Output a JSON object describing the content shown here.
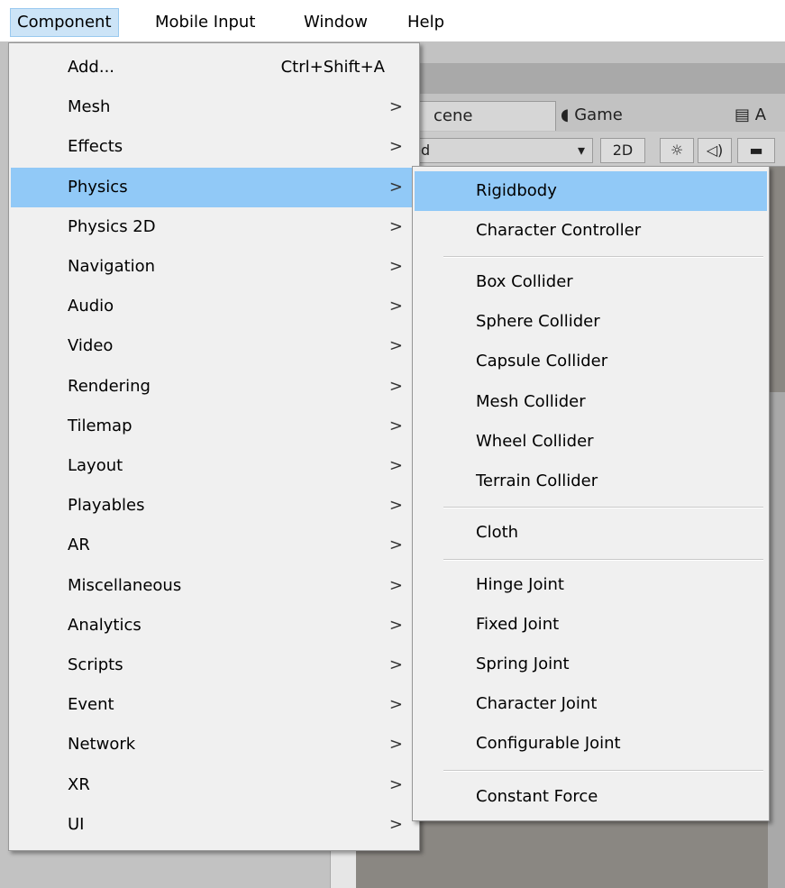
{
  "menubar": {
    "items": [
      "Component",
      "Mobile Input",
      "Window",
      "Help"
    ]
  },
  "editor": {
    "tabs": {
      "scene": "cene",
      "game": "Game",
      "asset": "A"
    },
    "toolbar": {
      "shading": "ded",
      "mode_2d": "2D",
      "dropdown_arrow": "▾"
    }
  },
  "component_menu": {
    "items": [
      {
        "label": "Add...",
        "shortcut": "Ctrl+Shift+A"
      },
      {
        "label": "Mesh",
        "arrow": ">"
      },
      {
        "label": "Effects",
        "arrow": ">"
      },
      {
        "label": "Physics",
        "arrow": ">"
      },
      {
        "label": "Physics 2D",
        "arrow": ">"
      },
      {
        "label": "Navigation",
        "arrow": ">"
      },
      {
        "label": "Audio",
        "arrow": ">"
      },
      {
        "label": "Video",
        "arrow": ">"
      },
      {
        "label": "Rendering",
        "arrow": ">"
      },
      {
        "label": "Tilemap",
        "arrow": ">"
      },
      {
        "label": "Layout",
        "arrow": ">"
      },
      {
        "label": "Playables",
        "arrow": ">"
      },
      {
        "label": "AR",
        "arrow": ">"
      },
      {
        "label": "Miscellaneous",
        "arrow": ">"
      },
      {
        "label": "Analytics",
        "arrow": ">"
      },
      {
        "label": "Scripts",
        "arrow": ">"
      },
      {
        "label": "Event",
        "arrow": ">"
      },
      {
        "label": "Network",
        "arrow": ">"
      },
      {
        "label": "XR",
        "arrow": ">"
      },
      {
        "label": "UI",
        "arrow": ">"
      }
    ],
    "highlighted": "Physics"
  },
  "physics_menu": {
    "items": [
      "Rigidbody",
      "Character Controller",
      "Box Collider",
      "Sphere Collider",
      "Capsule Collider",
      "Mesh Collider",
      "Wheel Collider",
      "Terrain Collider",
      "Cloth",
      "Hinge Joint",
      "Fixed Joint",
      "Spring Joint",
      "Character Joint",
      "Configurable Joint",
      "Constant Force"
    ],
    "highlighted": "Rigidbody"
  },
  "colors": {
    "menu_bg": "#f0f0f0",
    "highlight": "#91c9f7",
    "menubar_open": "#cce4f7"
  }
}
